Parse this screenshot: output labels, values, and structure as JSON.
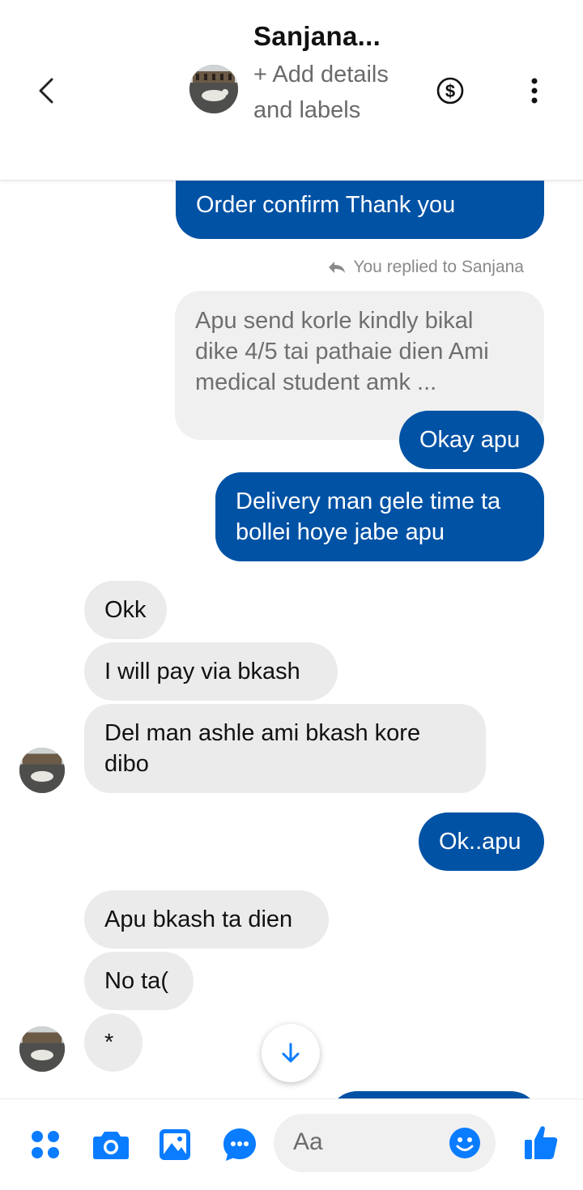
{
  "header": {
    "contact_name": "Sanjana...",
    "add_details": "+ Add details and labels"
  },
  "messages": [
    {
      "side": "out",
      "text": "Order confirm Thank you",
      "partial": true
    },
    {
      "type": "reply_note",
      "text": "You replied to Sanjana"
    },
    {
      "side": "quoted",
      "text": "Apu send korle kindly bikal dike 4/5 tai pathaie dien Ami medical student amk ..."
    },
    {
      "side": "out",
      "text": "Okay apu"
    },
    {
      "side": "out",
      "text": "Delivery man gele time ta bollei hoye jabe apu"
    },
    {
      "side": "in",
      "text": "Okk"
    },
    {
      "side": "in",
      "text": "I will pay via bkash"
    },
    {
      "side": "in",
      "text": "Del man ashle ami bkash kore dibo"
    },
    {
      "side": "out",
      "text": "Ok..apu"
    },
    {
      "side": "in",
      "text": "Apu bkash ta dien"
    },
    {
      "side": "in",
      "text": "No ta("
    },
    {
      "side": "in",
      "text": "*"
    }
  ],
  "composer": {
    "placeholder": "Aa"
  },
  "icons": {
    "back": "chevron-left-icon",
    "payment": "dollar-circle-icon",
    "more": "more-vertical-icon",
    "scroll_down": "arrow-down-icon",
    "apps": "grid-dots-icon",
    "camera": "camera-icon",
    "gallery": "image-icon",
    "chat_extras": "chat-bubble-icon",
    "emoji": "emoji-icon",
    "like": "thumbs-up-icon"
  },
  "colors": {
    "outgoing_bubble": "#0052a5",
    "incoming_bubble": "#ebebeb",
    "accent": "#0a7cff"
  }
}
